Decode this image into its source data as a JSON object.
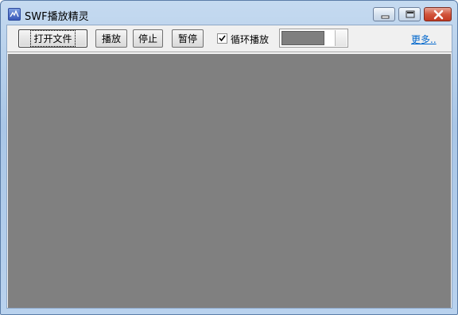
{
  "window": {
    "title": "SWF播放精灵",
    "icon": "swf-app-icon"
  },
  "toolbar": {
    "open_file_label": "打开文件",
    "play_label": "播放",
    "stop_label": "停止",
    "pause_label": "暂停",
    "loop_label": "循环播放",
    "loop_checked": true,
    "more_label": "更多..",
    "progress_fraction": 0.8
  },
  "player": {
    "background_color": "#808080"
  }
}
